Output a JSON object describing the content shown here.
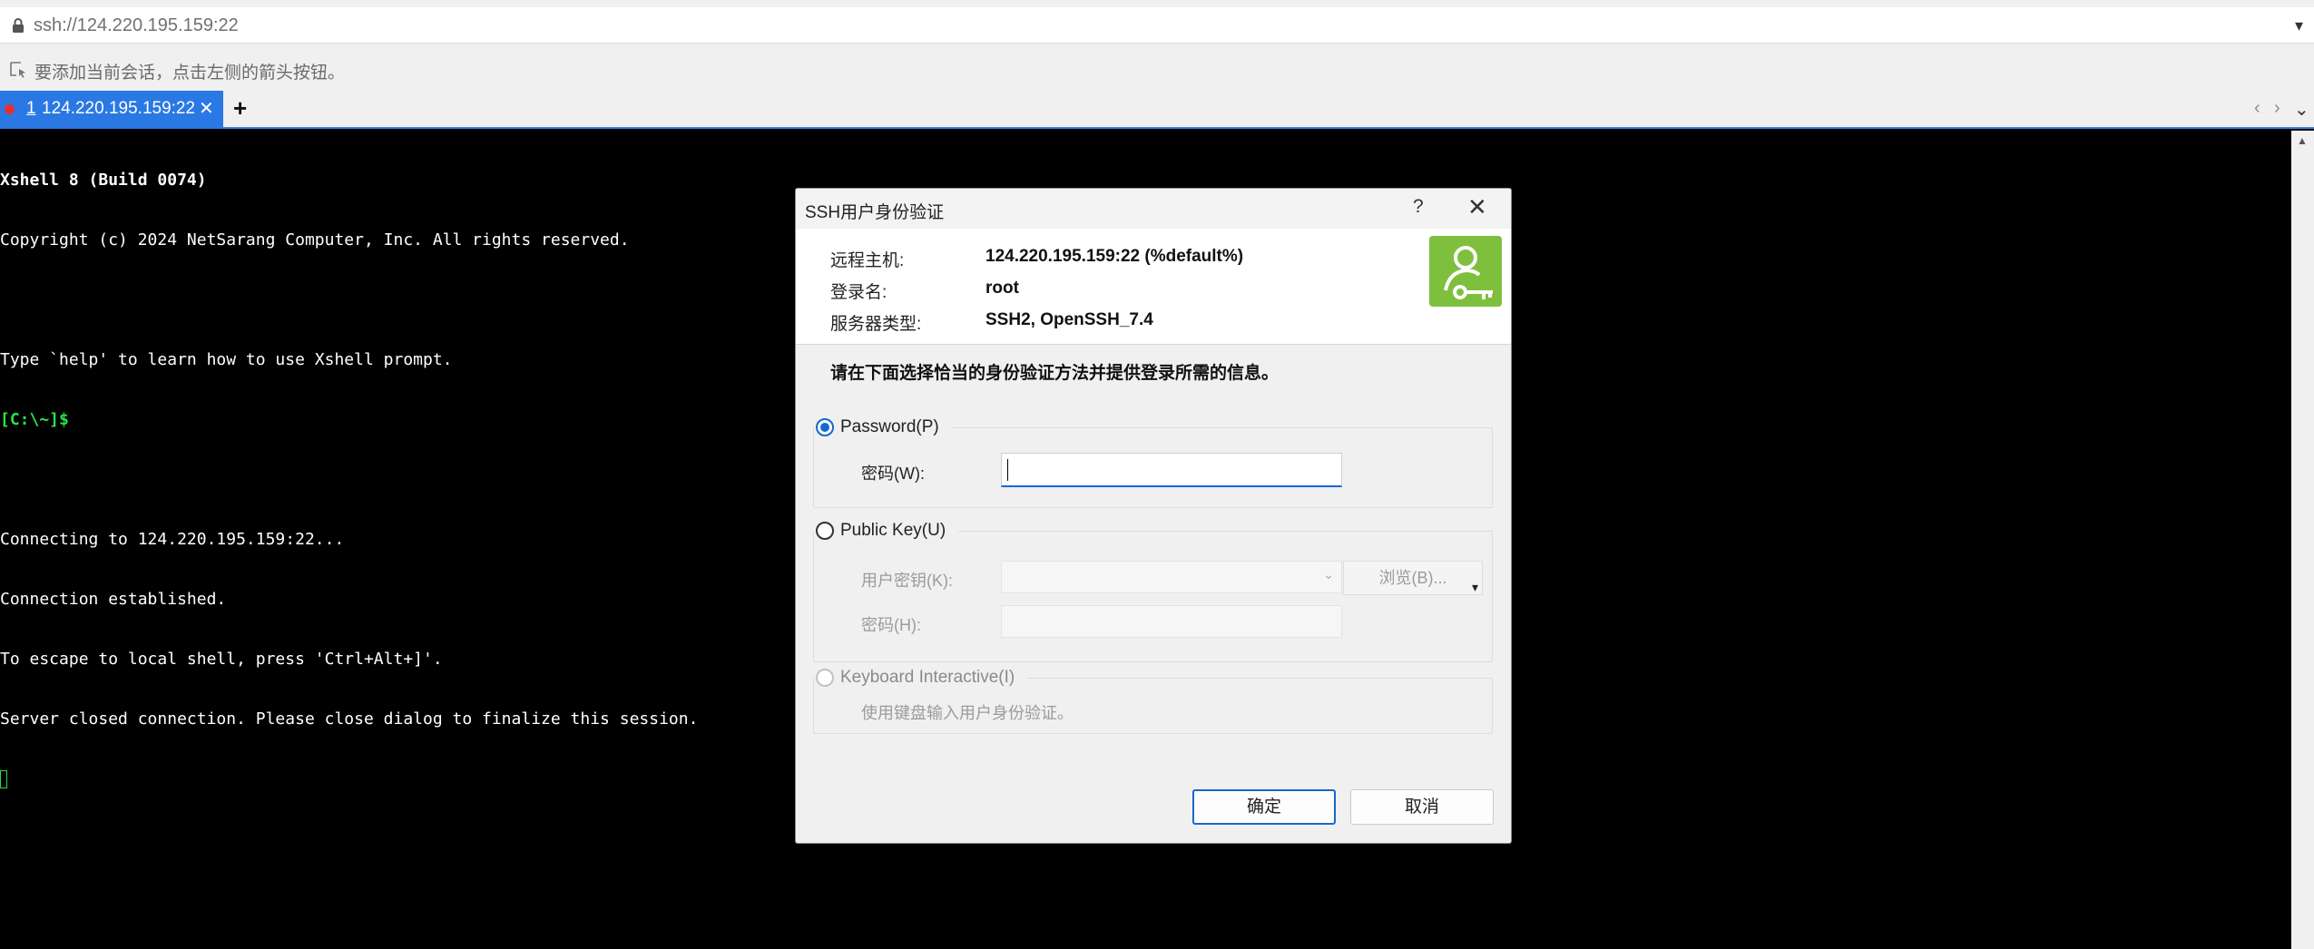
{
  "address_bar": {
    "url": "ssh://124.220.195.159:22",
    "icon": "lock-icon",
    "dropdown_icon": "chevron-down-icon"
  },
  "hint_bar": {
    "text": "要添加当前会话，点击左侧的箭头按钮。",
    "icon": "add-session-icon"
  },
  "tabs": [
    {
      "number": "1",
      "label": "124.220.195.159:22",
      "status": "disconnected",
      "status_color": "#e62f2f",
      "close": "✕"
    }
  ],
  "tab_bar": {
    "add_label": "+",
    "prev": "‹",
    "next": "›",
    "menu": "⌄"
  },
  "terminal": {
    "lines": [
      "Xshell 8 (Build 0074)",
      "Copyright (c) 2024 NetSarang Computer, Inc. All rights reserved.",
      "",
      "Type `help' to learn how to use Xshell prompt.",
      "[C:\\~]$",
      "",
      "Connecting to 124.220.195.159:22...",
      "Connection established.",
      "To escape to local shell, press 'Ctrl+Alt+]'.",
      "Server closed connection. Please close dialog to finalize this session."
    ],
    "prompt_color": "#27e34a"
  },
  "dialog": {
    "title": "SSH用户身份验证",
    "help": "?",
    "close": "✕",
    "info": {
      "host_label": "远程主机:",
      "host_value": "124.220.195.159:22 (%default%)",
      "user_label": "登录名:",
      "user_value": "root",
      "server_label": "服务器类型:",
      "server_value": "SSH2, OpenSSH_7.4"
    },
    "instruction": "请在下面选择恰当的身份验证方法并提供登录所需的信息。",
    "password_group": {
      "label": "Password(P)",
      "selected": true,
      "field_label": "密码(W):",
      "value": ""
    },
    "pubkey_group": {
      "label": "Public Key(U)",
      "selected": false,
      "key_label": "用户密钥(K):",
      "browse_label": "浏览(B)...",
      "pass_label": "密码(H):"
    },
    "keyboard_group": {
      "label": "Keyboard Interactive(I)",
      "selected": false,
      "enabled": false,
      "description": "使用键盘输入用户身份验证。"
    },
    "ok_label": "确定",
    "cancel_label": "取消",
    "accent_color": "#1467d3"
  }
}
